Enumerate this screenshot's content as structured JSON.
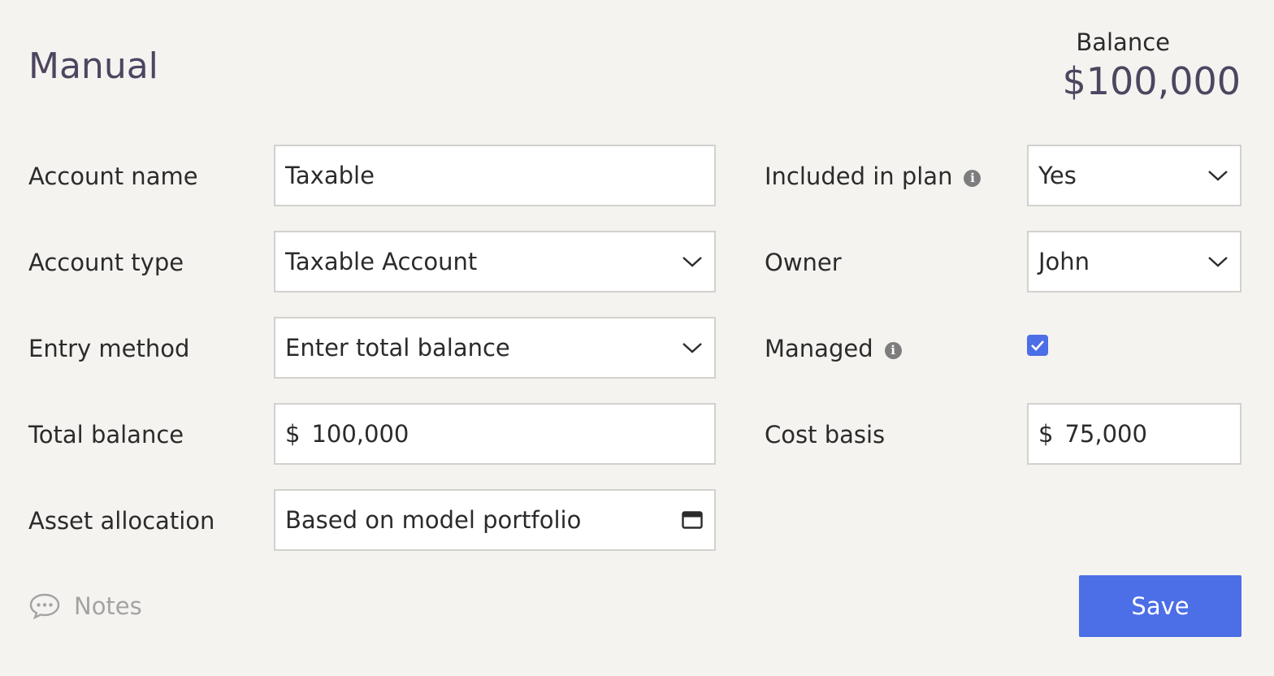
{
  "header": {
    "title": "Manual",
    "balance_label": "Balance",
    "balance_value": "$100,000"
  },
  "left": {
    "account_name": {
      "label": "Account name",
      "value": "Taxable"
    },
    "account_type": {
      "label": "Account type",
      "value": "Taxable Account",
      "icon": "chevron-down-icon"
    },
    "entry_method": {
      "label": "Entry method",
      "value": "Enter total balance",
      "icon": "chevron-down-icon"
    },
    "total_balance": {
      "label": "Total balance",
      "prefix": "$",
      "value": "100,000"
    },
    "asset_allocation": {
      "label": "Asset allocation",
      "value": "Based on model portfolio",
      "icon": "window-icon"
    }
  },
  "right": {
    "included_in_plan": {
      "label": "Included in plan",
      "value": "Yes",
      "info_icon": "i"
    },
    "owner": {
      "label": "Owner",
      "value": "John"
    },
    "managed": {
      "label": "Managed",
      "checked": true,
      "info_icon": "i"
    },
    "cost_basis": {
      "label": "Cost basis",
      "prefix": "$",
      "value": "75,000"
    }
  },
  "footer": {
    "notes_label": "Notes",
    "save_label": "Save"
  },
  "colors": {
    "background": "#f4f3f0",
    "accent": "#4c6ee6",
    "title": "#4e4560"
  }
}
